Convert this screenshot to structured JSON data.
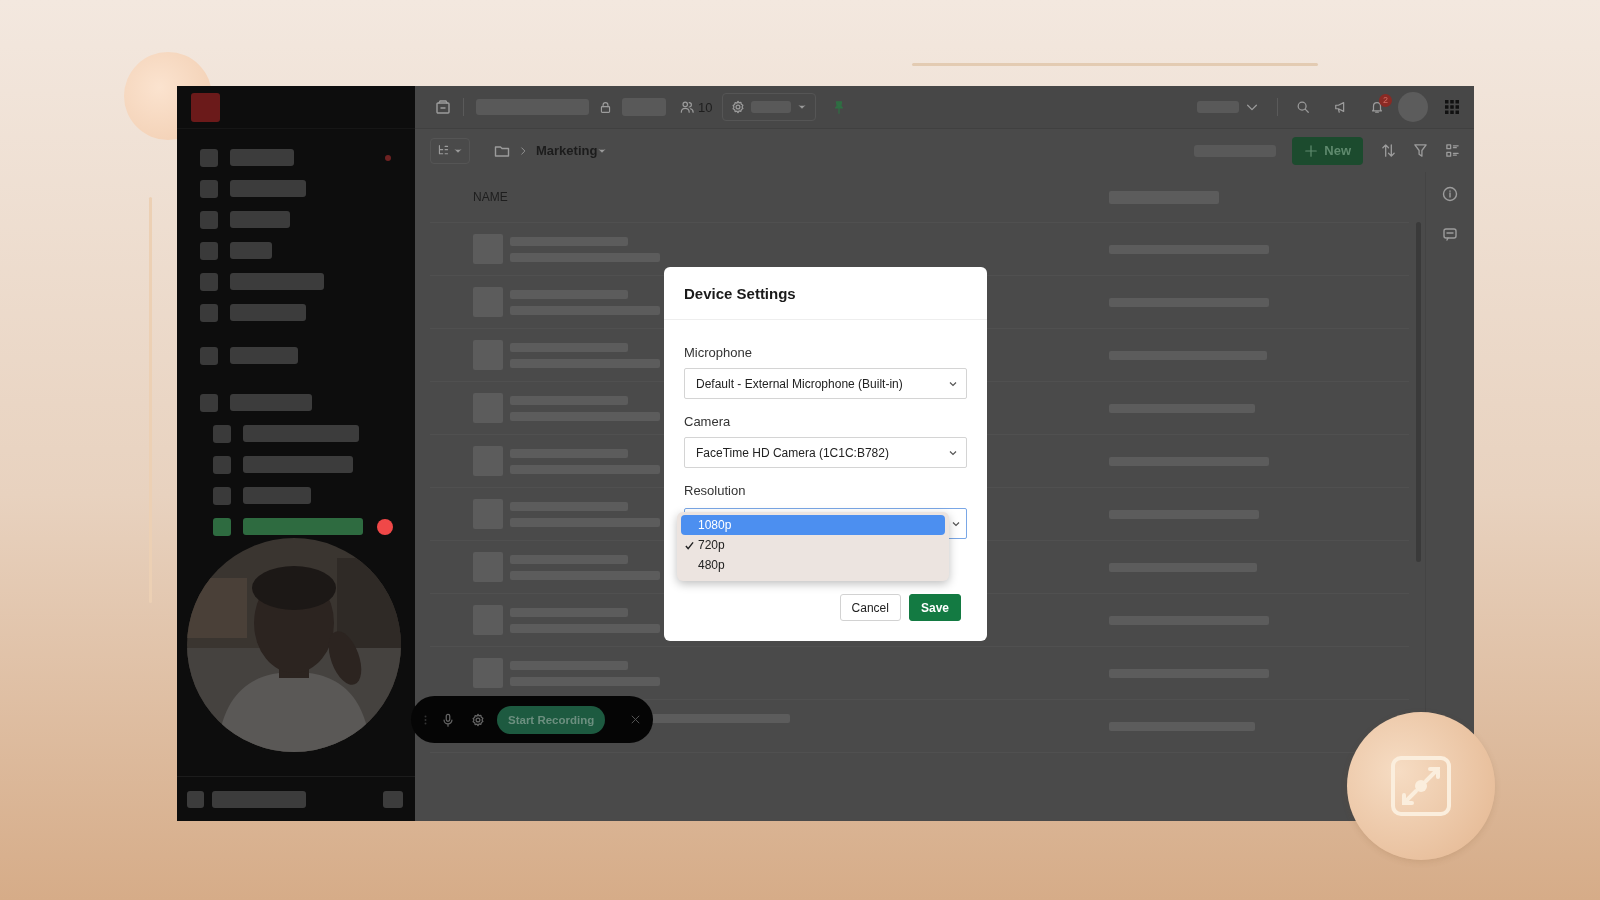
{
  "topbar": {
    "member_count": "10",
    "notification_count": "2"
  },
  "sidebar": {
    "items": [
      {
        "selected": false,
        "alert": true,
        "recording": false
      },
      {
        "selected": false,
        "alert": false,
        "recording": false
      },
      {
        "selected": false,
        "alert": false,
        "recording": false
      },
      {
        "selected": false,
        "alert": false,
        "recording": false
      },
      {
        "selected": false,
        "alert": false,
        "recording": false
      },
      {
        "selected": false,
        "alert": false,
        "recording": false
      },
      {
        "selected": false,
        "alert": false,
        "recording": false
      },
      {
        "selected": false,
        "alert": false,
        "recording": false,
        "children": [
          {
            "selected": false,
            "alert": false,
            "recording": false
          },
          {
            "selected": false,
            "alert": false,
            "recording": false
          },
          {
            "selected": false,
            "alert": false,
            "recording": false
          },
          {
            "selected": true,
            "alert": false,
            "recording": true
          }
        ]
      }
    ]
  },
  "breadcrumb": {
    "folder": "Marketing"
  },
  "toolbar": {
    "new_button": "New"
  },
  "table": {
    "columns": [
      "NAME"
    ]
  },
  "dialog": {
    "title": "Device Settings",
    "fields": [
      {
        "label": "Microphone",
        "value": "Default - External Microphone (Built-in)",
        "open": false
      },
      {
        "label": "Camera",
        "value": "FaceTime HD Camera (1C1C:B782)",
        "open": false
      },
      {
        "label": "Resolution",
        "open": true,
        "options": [
          {
            "label": "1080p",
            "highlighted": true,
            "selected": false
          },
          {
            "label": "720p",
            "highlighted": false,
            "selected": true
          },
          {
            "label": "480p",
            "highlighted": false,
            "selected": false
          }
        ]
      }
    ],
    "buttons": [
      {
        "label": "Cancel",
        "kind": "secondary"
      },
      {
        "label": "Save",
        "kind": "primary"
      }
    ]
  },
  "recording_bar": {
    "button": "Start Recording"
  }
}
